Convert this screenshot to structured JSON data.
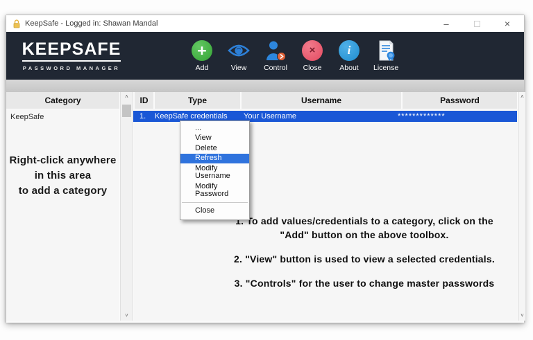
{
  "window": {
    "title": "KeepSafe - Logged in: Shawan Mandal",
    "controls": {
      "minimize": "–",
      "close": "×"
    }
  },
  "brand": {
    "name": "KEEPSAFE",
    "tagline": "PASSWORD MANAGER"
  },
  "toolbar": {
    "buttons": [
      {
        "label": "Add",
        "icon": "plus-circle-icon",
        "color": "#3fb33f"
      },
      {
        "label": "View",
        "icon": "eye-icon",
        "color": "#2d7fd6"
      },
      {
        "label": "Control",
        "icon": "user-settings-icon",
        "color": "#2d86dd"
      },
      {
        "label": "Close",
        "icon": "x-circle-icon",
        "color": "#ec5a70"
      },
      {
        "label": "About",
        "icon": "info-circle-icon",
        "color": "#2b9bd8"
      },
      {
        "label": "License",
        "icon": "certificate-icon",
        "color": "#2d86dd"
      }
    ],
    "about_glyph": "i",
    "add_glyph": "+",
    "close_glyph": "×"
  },
  "table": {
    "headers": {
      "category": "Category",
      "id": "ID",
      "type": "Type",
      "username": "Username",
      "password": "Password"
    },
    "rows": [
      {
        "id": "1.",
        "type": "KeepSafe credentials",
        "username": "Your Username",
        "password": "*************"
      }
    ],
    "selection_color": "#1a57d6"
  },
  "categories": {
    "items": [
      "KeepSafe"
    ],
    "hint": "Right-click anywhere\nin this area\nto add a category"
  },
  "context_menu": {
    "items": [
      "...",
      "View",
      "Delete",
      "Refresh",
      "Modify Username",
      "Modify Password",
      "Close"
    ],
    "highlighted": "Refresh",
    "highlight_color": "#2f73dd"
  },
  "instructions": [
    "1. To add values/credentials to a category, click on the\n\"Add\" button on the above toolbox.",
    "2. \"View\" button is used to view a selected credentials.",
    "3. \"Controls\"  for the user to change master passwords"
  ],
  "scrollbars": {
    "up_glyph": "˄",
    "down_glyph": "˅"
  },
  "colors": {
    "toolbar_bg": "#202733",
    "band": "#c9c9c9",
    "header_cell": "#e8e8e8",
    "lock_gold": "#e6b23c"
  }
}
